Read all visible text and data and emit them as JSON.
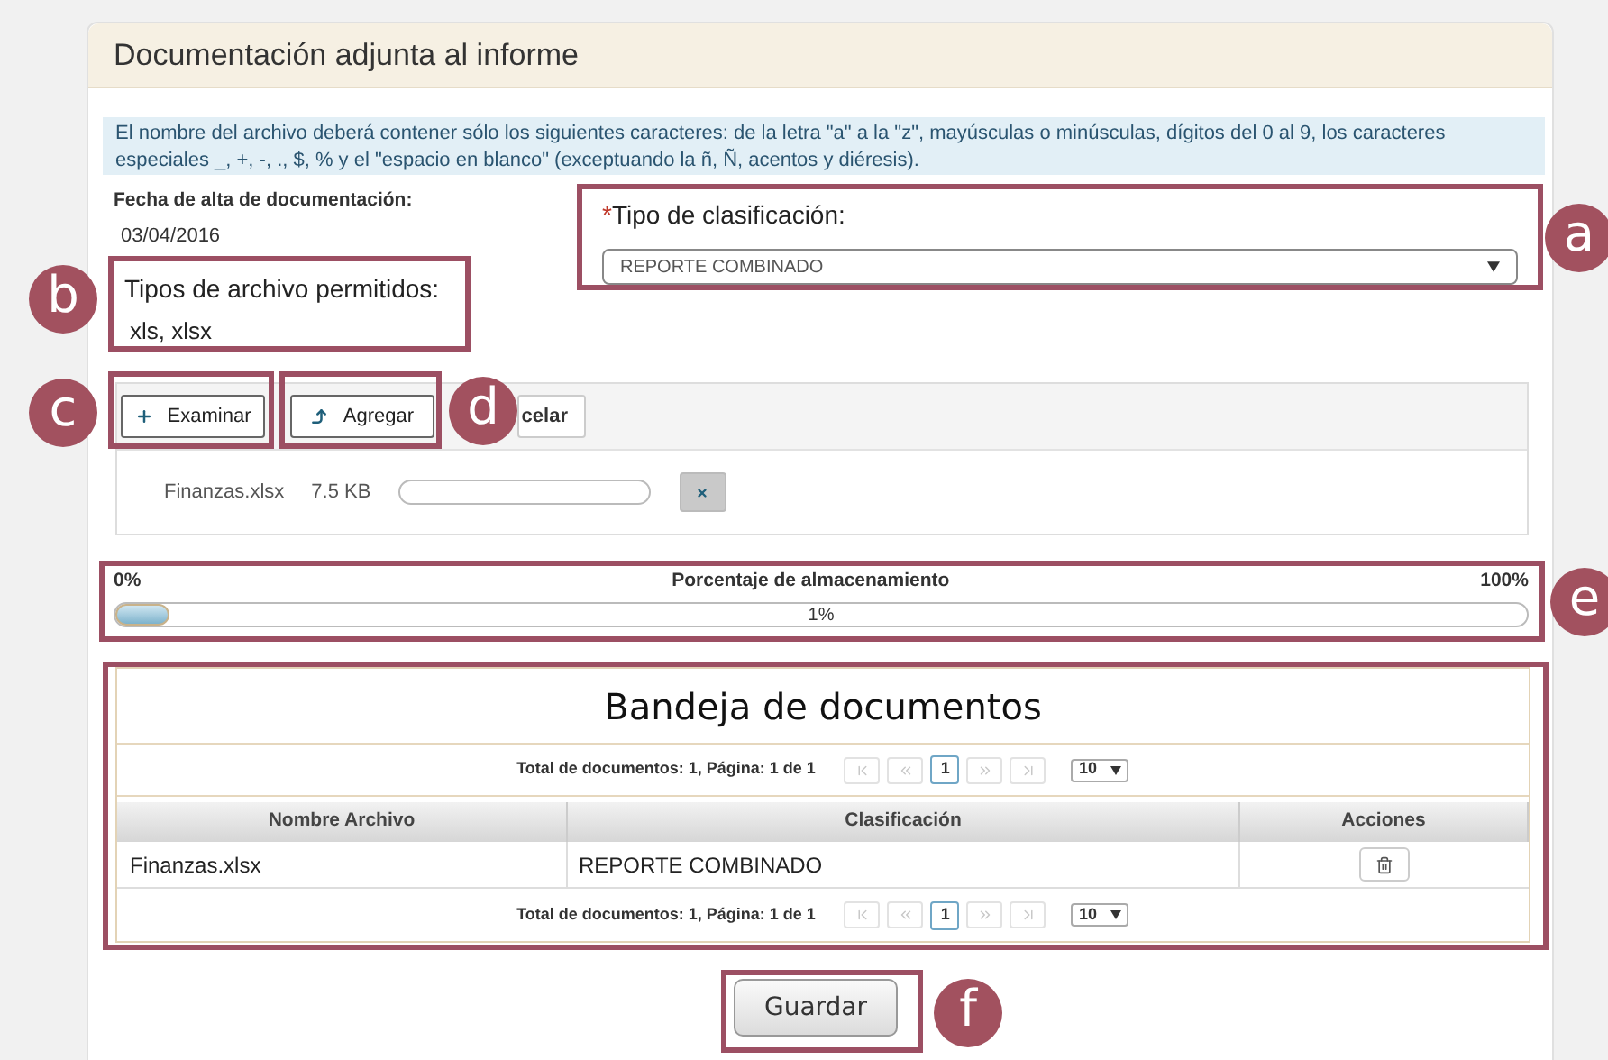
{
  "panel": {
    "title": "Documentación adjunta al informe"
  },
  "info": "El nombre del archivo deberá contener sólo los siguientes caracteres: de la letra \"a\" a la \"z\", mayúsculas o minúsculas, dígitos del 0 al 9, los caracteres especiales _, +, -, ., $, % y el \"espacio en blanco\" (exceptuando la ñ, Ñ, acentos y diéresis).",
  "date": {
    "label": "Fecha de alta de documentación:",
    "value": "03/04/2016"
  },
  "allowed": {
    "label": "Tipos de archivo permitidos:",
    "value": "xls, xlsx"
  },
  "classification": {
    "required_mark": "*",
    "label": "Tipo de clasificación:",
    "value": "REPORTE COMBINADO"
  },
  "upload": {
    "buttons": [
      {
        "kind": "browse",
        "label": "Examinar"
      },
      {
        "kind": "add",
        "label": "Agregar"
      },
      {
        "kind": "cancel",
        "label": "celar"
      }
    ],
    "files": [
      {
        "name": "Finanzas.xlsx",
        "size": "7.5 KB",
        "level": 0
      }
    ]
  },
  "storage": {
    "min": "0%",
    "title": "Porcentaje de almacenamiento",
    "max": "100%",
    "level": 0.01,
    "reading": "1%"
  },
  "tray": {
    "title": "Bandeja de documentos",
    "pagers": [
      {
        "summary": "Total de documentos: 1, Página: 1 de 1",
        "pages": [
          {
            "label": "1",
            "selected": true
          }
        ],
        "page_size": "10"
      },
      {
        "summary": "Total de documentos: 1, Página: 1 de 1",
        "pages": [
          {
            "label": "1",
            "selected": true
          }
        ],
        "page_size": "10"
      }
    ],
    "columns": [
      "Nombre Archivo",
      "Clasificación",
      "Acciones"
    ],
    "rows": [
      {
        "name": "Finanzas.xlsx",
        "classification": "REPORTE COMBINADO"
      }
    ]
  },
  "save_button": "Guardar",
  "callouts": [
    "a",
    "b",
    "c",
    "d",
    "e",
    "f"
  ]
}
